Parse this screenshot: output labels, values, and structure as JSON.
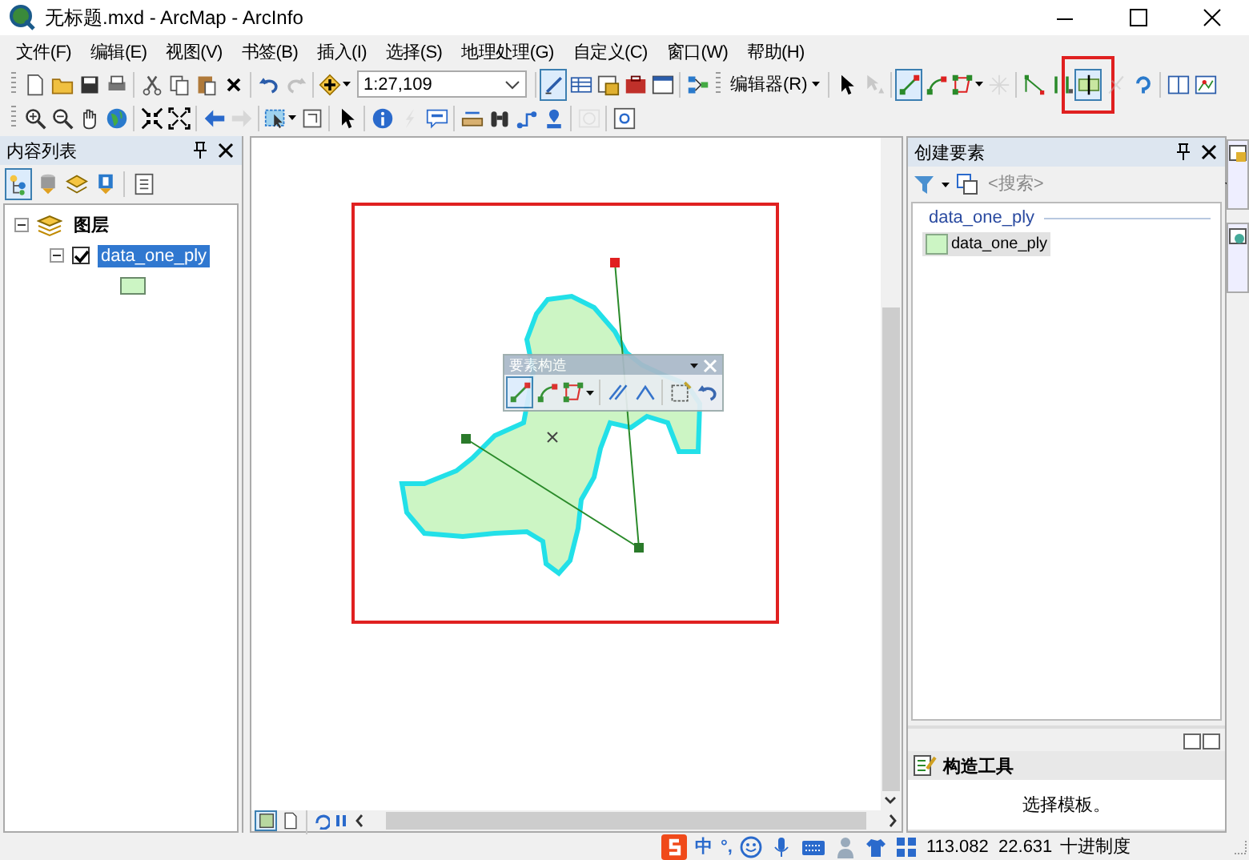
{
  "window": {
    "title": "无标题.mxd - ArcMap - ArcInfo"
  },
  "menus": [
    "文件(F)",
    "编辑(E)",
    "视图(V)",
    "书签(B)",
    "插入(I)",
    "选择(S)",
    "地理处理(G)",
    "自定义(C)",
    "窗口(W)",
    "帮助(H)"
  ],
  "toolbar_rows": [
    [
      {
        "kind": "new-file",
        "selected": false,
        "disabled": false,
        "highlighted": false
      },
      {
        "kind": "open-folder",
        "selected": false,
        "disabled": false,
        "highlighted": false
      },
      {
        "kind": "save",
        "selected": false,
        "disabled": false,
        "highlighted": false
      },
      {
        "kind": "print",
        "selected": false,
        "disabled": false,
        "highlighted": false
      },
      {
        "kind": "separator"
      },
      {
        "kind": "cut",
        "selected": false,
        "disabled": false,
        "highlighted": false
      },
      {
        "kind": "copy",
        "selected": false,
        "disabled": false,
        "highlighted": false
      },
      {
        "kind": "paste",
        "selected": false,
        "disabled": false,
        "highlighted": false
      },
      {
        "kind": "delete",
        "selected": false,
        "disabled": false,
        "highlighted": false
      },
      {
        "kind": "separator"
      },
      {
        "kind": "undo",
        "selected": false,
        "disabled": false,
        "highlighted": false
      },
      {
        "kind": "redo",
        "selected": false,
        "disabled": true,
        "highlighted": false
      },
      {
        "kind": "separator"
      },
      {
        "kind": "add-data",
        "selected": false,
        "disabled": false,
        "highlighted": false
      },
      {
        "kind": "scale-box",
        "value": "1:27,109"
      },
      {
        "kind": "separator"
      },
      {
        "kind": "editor-toolbar",
        "selected": true,
        "disabled": false,
        "highlighted": false
      },
      {
        "kind": "table",
        "selected": false,
        "disabled": false,
        "highlighted": false
      },
      {
        "kind": "catalog",
        "selected": false,
        "disabled": false,
        "highlighted": false
      },
      {
        "kind": "toolbox",
        "selected": false,
        "disabled": false,
        "highlighted": false
      },
      {
        "kind": "python",
        "selected": false,
        "disabled": false,
        "highlighted": false
      },
      {
        "kind": "separator"
      },
      {
        "kind": "model-builder",
        "selected": false,
        "disabled": false,
        "highlighted": false
      },
      {
        "kind": "grip"
      },
      {
        "kind": "menu-button",
        "label": "编辑器(R)"
      },
      {
        "kind": "separator"
      },
      {
        "kind": "pointer",
        "selected": false,
        "disabled": false,
        "highlighted": false
      },
      {
        "kind": "edit-annotation",
        "selected": false,
        "disabled": true,
        "highlighted": false
      },
      {
        "kind": "separator"
      },
      {
        "kind": "straight-segment",
        "selected": true,
        "disabled": false,
        "highlighted": false
      },
      {
        "kind": "endpoint-arc",
        "selected": false,
        "disabled": false,
        "highlighted": false
      },
      {
        "kind": "trace",
        "selected": false,
        "disabled": false,
        "highlighted": false
      },
      {
        "kind": "midpoint",
        "selected": false,
        "disabled": true,
        "highlighted": false
      },
      {
        "kind": "separator"
      },
      {
        "kind": "reshape",
        "selected": false,
        "disabled": false,
        "highlighted": false
      },
      {
        "kind": "split",
        "selected": false,
        "disabled": false,
        "highlighted": false
      },
      {
        "kind": "cut-polygons",
        "selected": true,
        "disabled": false,
        "highlighted": true
      },
      {
        "kind": "delete-vertex",
        "selected": false,
        "disabled": true,
        "highlighted": false
      },
      {
        "kind": "rotate",
        "selected": false,
        "disabled": false,
        "highlighted": false
      },
      {
        "kind": "separator"
      },
      {
        "kind": "attributes",
        "selected": false,
        "disabled": false,
        "highlighted": false
      },
      {
        "kind": "sketch-properties",
        "selected": false,
        "disabled": false,
        "highlighted": false
      }
    ],
    [
      {
        "kind": "zoom-in",
        "selected": false,
        "disabled": false,
        "highlighted": false
      },
      {
        "kind": "zoom-out",
        "selected": false,
        "disabled": false,
        "highlighted": false
      },
      {
        "kind": "pan",
        "selected": false,
        "disabled": false,
        "highlighted": false
      },
      {
        "kind": "full-extent",
        "selected": false,
        "disabled": false,
        "highlighted": false
      },
      {
        "kind": "separator"
      },
      {
        "kind": "fixed-zoom-in",
        "selected": false,
        "disabled": false,
        "highlighted": false
      },
      {
        "kind": "fixed-zoom-out",
        "selected": false,
        "disabled": false,
        "highlighted": false
      },
      {
        "kind": "separator"
      },
      {
        "kind": "back",
        "selected": false,
        "disabled": false,
        "highlighted": false
      },
      {
        "kind": "forward",
        "selected": false,
        "disabled": true,
        "highlighted": false
      },
      {
        "kind": "separator"
      },
      {
        "kind": "select-features",
        "selected": false,
        "disabled": false,
        "highlighted": false
      },
      {
        "kind": "clear-selection",
        "selected": false,
        "disabled": false,
        "highlighted": false
      },
      {
        "kind": "separator"
      },
      {
        "kind": "pointer",
        "selected": false,
        "disabled": false,
        "highlighted": false
      },
      {
        "kind": "separator"
      },
      {
        "kind": "identify",
        "selected": false,
        "disabled": false,
        "highlighted": false
      },
      {
        "kind": "hyperlink",
        "selected": false,
        "disabled": true,
        "highlighted": false
      },
      {
        "kind": "html-popup",
        "selected": false,
        "disabled": false,
        "highlighted": false
      },
      {
        "kind": "separator"
      },
      {
        "kind": "measure",
        "selected": false,
        "disabled": false,
        "highlighted": false
      },
      {
        "kind": "find",
        "selected": false,
        "disabled": false,
        "highlighted": false
      },
      {
        "kind": "route",
        "selected": false,
        "disabled": false,
        "highlighted": false
      },
      {
        "kind": "go-to-xy",
        "selected": false,
        "disabled": false,
        "highlighted": false
      },
      {
        "kind": "separator"
      },
      {
        "kind": "time-slider",
        "selected": false,
        "disabled": true,
        "highlighted": false
      },
      {
        "kind": "separator"
      },
      {
        "kind": "viewer",
        "selected": false,
        "disabled": false,
        "highlighted": false
      }
    ]
  ],
  "toc": {
    "title": "内容列表",
    "tools": [
      {
        "kind": "list-drawing-order",
        "selected": true
      },
      {
        "kind": "list-source",
        "selected": false
      },
      {
        "kind": "list-visibility",
        "selected": false
      },
      {
        "kind": "list-selection",
        "selected": false
      },
      {
        "kind": "options",
        "selected": false
      }
    ],
    "tree": [
      {
        "label": "图层",
        "expanded": true,
        "children": [
          {
            "label": "data_one_ply",
            "checked": true,
            "selected": true,
            "expanded": true,
            "color": "#ccf5c4"
          }
        ]
      }
    ]
  },
  "construction_toolbar": {
    "title": "要素构造",
    "tools": [
      {
        "kind": "straight-segment",
        "selected": true
      },
      {
        "kind": "endpoint-arc",
        "selected": false
      },
      {
        "kind": "trace",
        "selected": false
      },
      {
        "kind": "separator"
      },
      {
        "kind": "parallel",
        "selected": false
      },
      {
        "kind": "perpendicular",
        "selected": false
      },
      {
        "kind": "separator"
      },
      {
        "kind": "finish-sketch",
        "selected": false
      },
      {
        "kind": "undo",
        "selected": false
      }
    ]
  },
  "create_features": {
    "title": "创建要素",
    "search": {
      "placeholder": "<搜索>"
    },
    "groups": [
      {
        "label": "data_one_ply",
        "templates": [
          {
            "label": "data_one_ply",
            "color": "#ccf5c4",
            "selected": true
          }
        ]
      }
    ],
    "construction_tools": {
      "title": "构造工具",
      "message": "选择模板。"
    }
  },
  "map_view": {
    "views": [
      {
        "kind": "data-view",
        "selected": true
      },
      {
        "kind": "layout-view",
        "selected": false
      }
    ]
  },
  "status_bar": {
    "ime_mode": "中",
    "ime_punctuation": "°,",
    "coordinates": "113.082  22.631",
    "units": "十进制度"
  }
}
